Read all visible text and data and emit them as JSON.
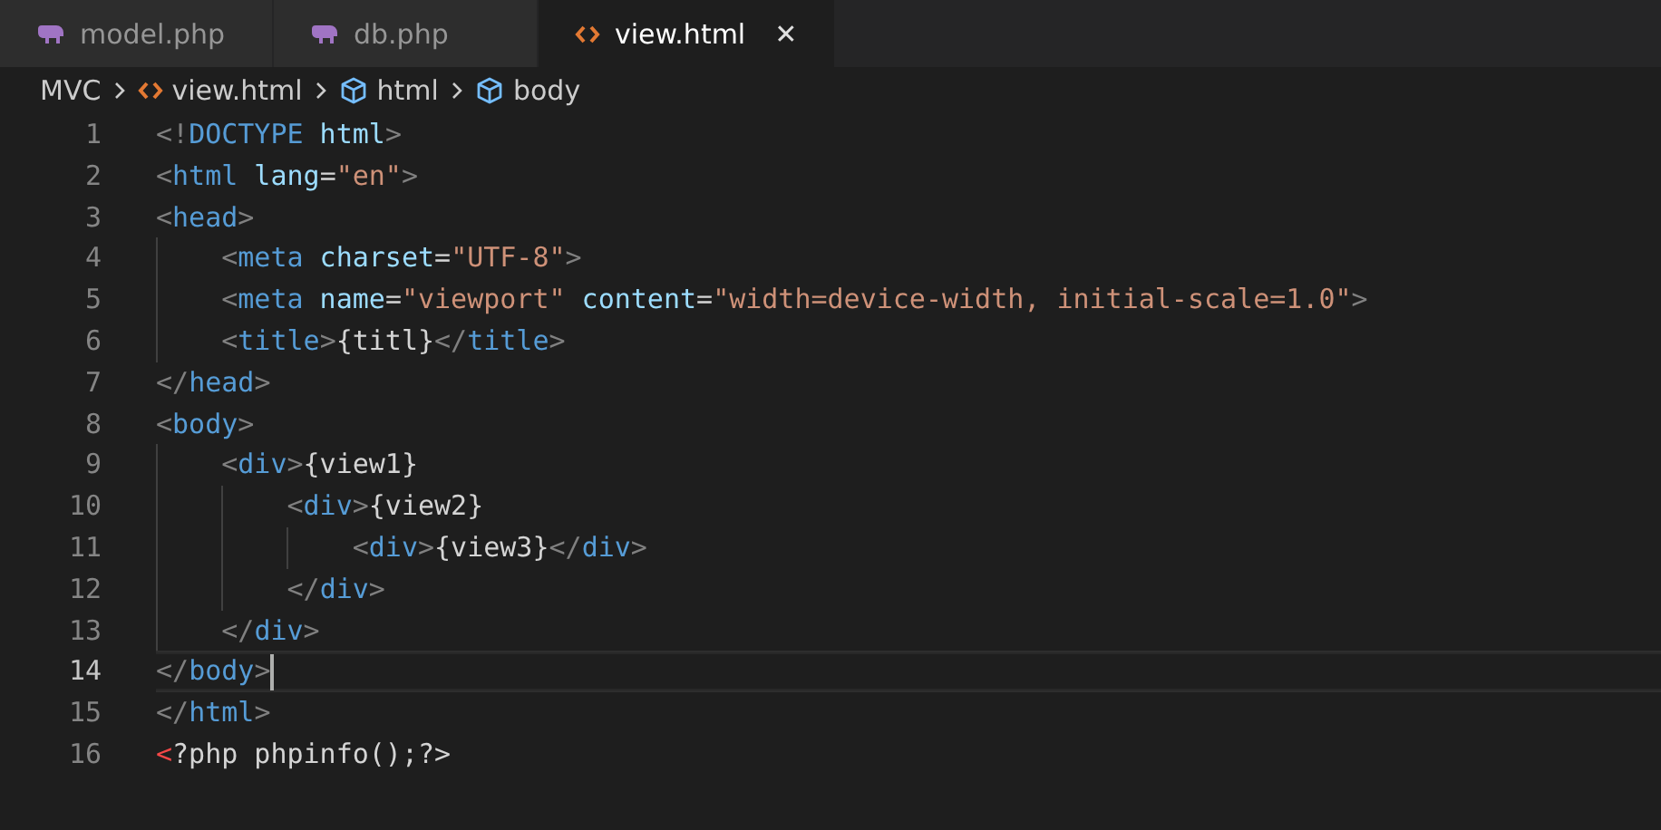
{
  "tabs": [
    {
      "label": "model.php",
      "kind": "php",
      "selected": false
    },
    {
      "label": "db.php",
      "kind": "php",
      "selected": false
    },
    {
      "label": "view.html",
      "kind": "html",
      "selected": true,
      "close": "✕"
    }
  ],
  "breadcrumb": [
    {
      "label": "MVC",
      "kind": "folder"
    },
    {
      "label": "view.html",
      "kind": "html"
    },
    {
      "label": "html",
      "kind": "element"
    },
    {
      "label": "body",
      "kind": "element"
    }
  ],
  "lines": [
    {
      "number": "1",
      "current": false,
      "tokens": [
        {
          "kind": "punct",
          "text": "<!"
        },
        {
          "kind": "tag",
          "text": "DOCTYPE"
        },
        {
          "kind": "attr",
          "text": " html"
        },
        {
          "kind": "punct",
          "text": ">"
        }
      ]
    },
    {
      "number": "2",
      "current": false,
      "tokens": [
        {
          "kind": "punct",
          "text": "<"
        },
        {
          "kind": "tag",
          "text": "html"
        },
        {
          "kind": "attr",
          "text": " lang"
        },
        {
          "kind": "text",
          "text": "="
        },
        {
          "kind": "string",
          "text": "\"en\""
        },
        {
          "kind": "punct",
          "text": ">"
        }
      ]
    },
    {
      "number": "3",
      "current": false,
      "tokens": [
        {
          "kind": "punct",
          "text": "<"
        },
        {
          "kind": "tag",
          "text": "head"
        },
        {
          "kind": "punct",
          "text": ">"
        }
      ]
    },
    {
      "number": "4",
      "current": false,
      "tokens": [
        {
          "kind": "punct",
          "text": "    <"
        },
        {
          "kind": "tag",
          "text": "meta"
        },
        {
          "kind": "attr",
          "text": " charset"
        },
        {
          "kind": "text",
          "text": "="
        },
        {
          "kind": "string",
          "text": "\"UTF-8\""
        },
        {
          "kind": "punct",
          "text": ">"
        }
      ]
    },
    {
      "number": "5",
      "current": false,
      "tokens": [
        {
          "kind": "punct",
          "text": "    <"
        },
        {
          "kind": "tag",
          "text": "meta"
        },
        {
          "kind": "attr",
          "text": " name"
        },
        {
          "kind": "text",
          "text": "="
        },
        {
          "kind": "string",
          "text": "\"viewport\""
        },
        {
          "kind": "attr",
          "text": " content"
        },
        {
          "kind": "text",
          "text": "="
        },
        {
          "kind": "string",
          "text": "\"width=device-width, initial-scale=1.0\""
        },
        {
          "kind": "punct",
          "text": ">"
        }
      ]
    },
    {
      "number": "6",
      "current": false,
      "tokens": [
        {
          "kind": "punct",
          "text": "    <"
        },
        {
          "kind": "tag",
          "text": "title"
        },
        {
          "kind": "punct",
          "text": ">"
        },
        {
          "kind": "text",
          "text": "{titl}"
        },
        {
          "kind": "punct",
          "text": "</"
        },
        {
          "kind": "tag",
          "text": "title"
        },
        {
          "kind": "punct",
          "text": ">"
        }
      ]
    },
    {
      "number": "7",
      "current": false,
      "tokens": [
        {
          "kind": "punct",
          "text": "</"
        },
        {
          "kind": "tag",
          "text": "head"
        },
        {
          "kind": "punct",
          "text": ">"
        }
      ]
    },
    {
      "number": "8",
      "current": false,
      "tokens": [
        {
          "kind": "punct",
          "text": "<"
        },
        {
          "kind": "tag",
          "text": "body"
        },
        {
          "kind": "punct",
          "text": ">"
        }
      ]
    },
    {
      "number": "9",
      "current": false,
      "tokens": [
        {
          "kind": "punct",
          "text": "    <"
        },
        {
          "kind": "tag",
          "text": "div"
        },
        {
          "kind": "punct",
          "text": ">"
        },
        {
          "kind": "text",
          "text": "{view1}"
        }
      ]
    },
    {
      "number": "10",
      "current": false,
      "tokens": [
        {
          "kind": "punct",
          "text": "        <"
        },
        {
          "kind": "tag",
          "text": "div"
        },
        {
          "kind": "punct",
          "text": ">"
        },
        {
          "kind": "text",
          "text": "{view2}"
        }
      ]
    },
    {
      "number": "11",
      "current": false,
      "tokens": [
        {
          "kind": "punct",
          "text": "            <"
        },
        {
          "kind": "tag",
          "text": "div"
        },
        {
          "kind": "punct",
          "text": ">"
        },
        {
          "kind": "text",
          "text": "{view3}"
        },
        {
          "kind": "punct",
          "text": "</"
        },
        {
          "kind": "tag",
          "text": "div"
        },
        {
          "kind": "punct",
          "text": ">"
        }
      ]
    },
    {
      "number": "12",
      "current": false,
      "tokens": [
        {
          "kind": "punct",
          "text": "        </"
        },
        {
          "kind": "tag",
          "text": "div"
        },
        {
          "kind": "punct",
          "text": ">"
        }
      ]
    },
    {
      "number": "13",
      "current": false,
      "tokens": [
        {
          "kind": "punct",
          "text": "    </"
        },
        {
          "kind": "tag",
          "text": "div"
        },
        {
          "kind": "punct",
          "text": ">"
        }
      ]
    },
    {
      "number": "14",
      "current": true,
      "tokens": [
        {
          "kind": "punct",
          "text": "</"
        },
        {
          "kind": "tag",
          "text": "body"
        },
        {
          "kind": "punct",
          "text": ">"
        }
      ]
    },
    {
      "number": "15",
      "current": false,
      "tokens": [
        {
          "kind": "punct",
          "text": "</"
        },
        {
          "kind": "tag",
          "text": "html"
        },
        {
          "kind": "punct",
          "text": ">"
        }
      ]
    },
    {
      "number": "16",
      "current": false,
      "tokens": [
        {
          "kind": "php",
          "text": "<"
        },
        {
          "kind": "text",
          "text": "?php phpinfo();?>"
        }
      ]
    }
  ]
}
